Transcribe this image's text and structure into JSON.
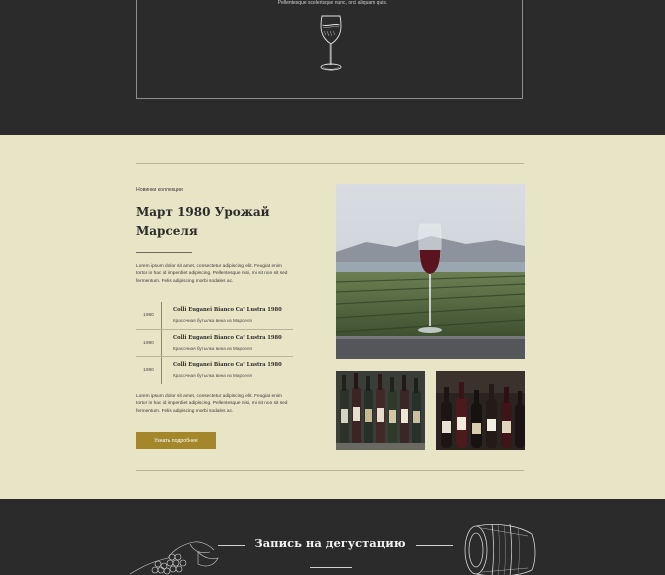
{
  "top_section": {
    "tagline": "Pellentesque scelerisque nunc, orci aliquam quis."
  },
  "collection": {
    "eyebrow": "Новинки коллекции",
    "title": "Март 1980 Урожай Марселя",
    "intro": "Lorem ipsum dolor sit amet, consectetur adipiscing elit. Feugiat enim tortor in hac id imperdiet adipiscing. Pellentesque nisi, mi sit non sit sed fermentum. Felis adipiscing morbi sodales ac.",
    "wines": [
      {
        "year": "1980",
        "name": "Colli Euganei Bianco Ca' Lustra 1980",
        "desc": "Красочная бутылка вина из Марселя"
      },
      {
        "year": "1980",
        "name": "Colli Euganei Bianco Ca' Lustra 1980",
        "desc": "Красочная бутылка вина из Марселя"
      },
      {
        "year": "1980",
        "name": "Colli Euganei Bianco Ca' Lustra 1980",
        "desc": "Красочная бутылка вина из Марселя"
      }
    ],
    "outro": "Lorem ipsum dolor sit amet, consectetur adipiscing elit. Feugiat enim tortor in hac id imperdiet adipiscing. Pellentesque nisi, mi sit non sit sed fermentum. Felis adipiscing morbi sodales ac.",
    "button_label": "Узнать подробнее"
  },
  "tasting": {
    "title": "Запись на дегустацию"
  },
  "colors": {
    "dark_bg": "#2b2b2b",
    "cream_bg": "#e8e4c6",
    "accent_gold": "#a3872a"
  }
}
